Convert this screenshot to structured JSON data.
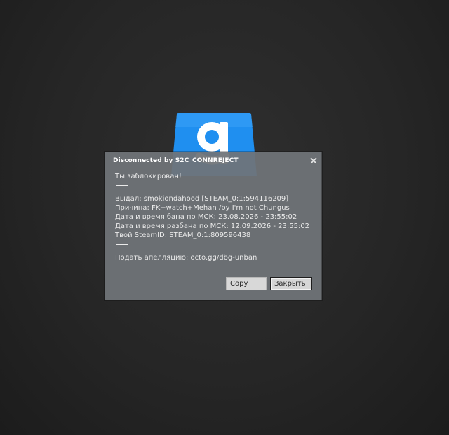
{
  "logo": {
    "icon": "garrysmod-g-icon",
    "color": "#1f8ff0"
  },
  "dialog": {
    "title": "Disconnected by S2C_CONNREJECT",
    "close_icon": "close-icon",
    "message": {
      "banned_line": "Ты заблокирован!",
      "separator": "___",
      "issued_by": "Выдал: smokiondahood [STEAM_0:1:594116209]",
      "reason": "Причина: FK+watch+Mehan /by I'm not Chungus",
      "ban_datetime": "Дата и время бана по МСК: 23.08.2026 - 23:55:02",
      "unban_datetime": "Дата и время разбана по МСК: 12.09.2026 - 23:55:02",
      "steam_id": "Твой SteamID: STEAM_0:1:809596438",
      "appeal": "Подать апелляцию: octo.gg/dbg-unban"
    },
    "buttons": {
      "copy": "Copy",
      "close": "Закрыть"
    }
  }
}
